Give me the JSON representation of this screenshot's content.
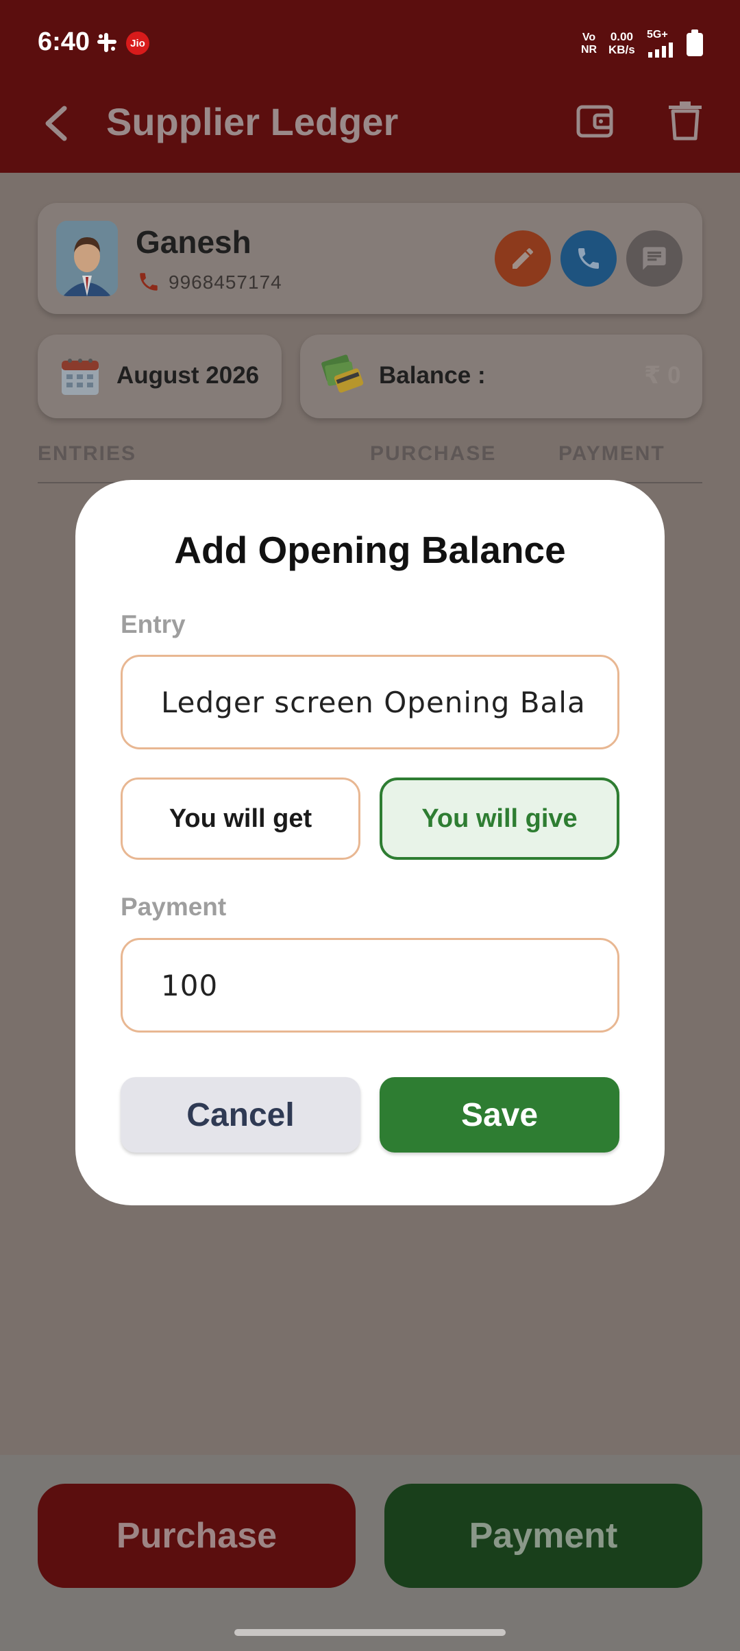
{
  "status_bar": {
    "time": "6:40",
    "carrier_badge": "Jio",
    "vonr_line1": "Vo",
    "vonr_line2": "NR",
    "speed_value": "0.00",
    "speed_unit": "KB/s",
    "network": "5G+"
  },
  "app_bar": {
    "title": "Supplier Ledger"
  },
  "supplier": {
    "name": "Ganesh",
    "phone": "9968457174"
  },
  "summary": {
    "month": "August 2026",
    "balance_label": "Balance :",
    "balance_value": "₹ 0"
  },
  "columns": {
    "entries": "ENTRIES",
    "purchase": "PURCHASE",
    "payment": "PAYMENT"
  },
  "dialog": {
    "title": "Add Opening Balance",
    "entry_label": "Entry",
    "entry_value": "Ledger screen Opening Balan",
    "you_will_get": "You will get",
    "you_will_give": "You will give",
    "payment_label": "Payment",
    "payment_value": "100",
    "cancel": "Cancel",
    "save": "Save"
  },
  "bottom_buttons": {
    "purchase": "Purchase",
    "payment": "Payment"
  },
  "colors": {
    "brand_dark_red": "#5b0e0e",
    "accent_green": "#2e7d32",
    "field_border": "#e8b792"
  }
}
